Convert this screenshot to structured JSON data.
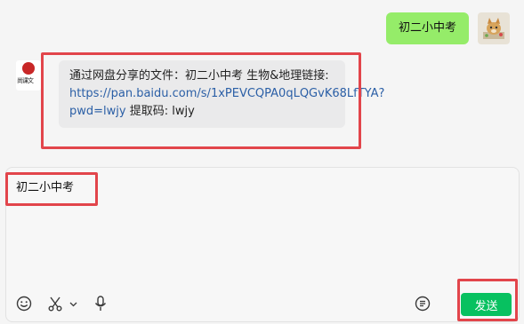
{
  "sent_message": {
    "text": "初二小中考"
  },
  "received_message": {
    "prefix": "通过网盘分享的文件：初二小中考 生物&地理链接: ",
    "link": "https://pan.baidu.com/s/1xPEVCQPA0qLQGvK68LfTYA?pwd=lwjy",
    "suffix": " 提取码: lwjy",
    "sender_logo_text": "尚课文"
  },
  "input": {
    "value": "初二小中考"
  },
  "toolbar": {
    "send_label": "发送"
  },
  "icons": [
    "emoji-icon",
    "scissors-icon",
    "chevron-down-icon",
    "microphone-icon",
    "chat-history-icon"
  ],
  "colors": {
    "green_bubble": "#95ec69",
    "send_button": "#07c160",
    "highlight": "#e2454b",
    "link": "#2b5fa6"
  }
}
